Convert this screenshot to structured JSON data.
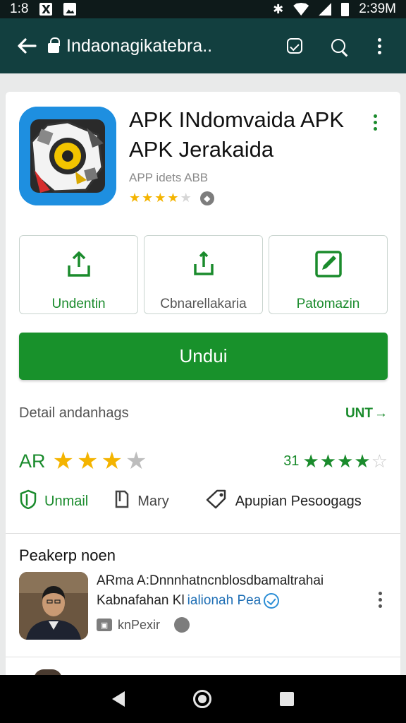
{
  "status_bar": {
    "time_left": "1:8",
    "time_right": "2:39M",
    "icons": [
      "notification-x-icon",
      "gallery-icon",
      "bluetooth-icon",
      "wifi-icon",
      "signal-icon",
      "battery-icon"
    ]
  },
  "toolbar": {
    "url": "Indaonagikatebra..",
    "icons": [
      "back-arrow-icon",
      "lock-icon",
      "tab-switcher-icon",
      "search-icon",
      "overflow-menu-icon"
    ]
  },
  "app": {
    "title": "APK INdomvaida APK APK Jerakaida",
    "subtitle": "APP idets ABB",
    "rating_stars": 4.5,
    "badge_icon": "info-badge-icon"
  },
  "actions": [
    {
      "label": "Undentin",
      "icon": "upload-icon"
    },
    {
      "label": "Cbnarellakaria",
      "icon": "share-icon"
    },
    {
      "label": "Patomazin",
      "icon": "edit-icon"
    }
  ],
  "install_button": {
    "label": "Undui"
  },
  "detail": {
    "label": "Detail andanhags",
    "link": "UNT"
  },
  "ratings": {
    "left_code": "AR",
    "left_stars": 3,
    "right_code": "31",
    "right_stars": 4.5
  },
  "meta": [
    {
      "label": "Unmail",
      "icon": "shield-icon"
    },
    {
      "label": "Mary",
      "icon": "bookmark-icon"
    },
    {
      "label": "Apupian Pesoogags",
      "icon": "tag-icon"
    }
  ],
  "reviews_section": {
    "title": "Peakerp noen",
    "review": {
      "line1": "ARma A:Dnnnhatncnblosdbamaltrahai",
      "line2_plain": "Kabnafahan Kl",
      "line2_accent": "ialionah Pea",
      "source": "knPexir"
    }
  },
  "colors": {
    "toolbar": "#123f3f",
    "accent_green": "#18912b",
    "star_yellow": "#f4b400"
  }
}
